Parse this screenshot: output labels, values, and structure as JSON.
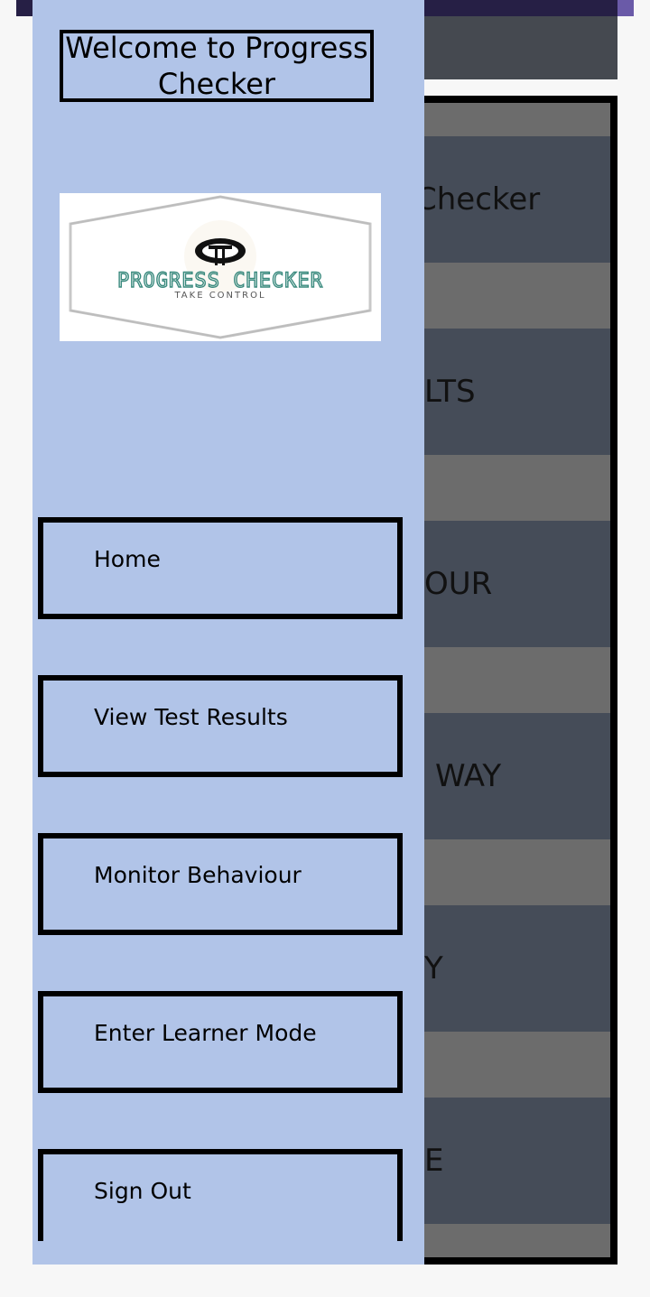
{
  "background": {
    "tiles": [
      {
        "text": "Checker"
      },
      {
        "text": "LTS"
      },
      {
        "text": "OUR"
      },
      {
        "text": "WAY"
      },
      {
        "text": "Y"
      },
      {
        "text": "E"
      }
    ]
  },
  "drawer": {
    "title": "Welcome to Progress Checker",
    "logo": {
      "brand": "PROGRESS CHECKER",
      "tagline": "TAKE CONTROL",
      "icon": "brain-icon"
    },
    "menu": [
      {
        "label": "Home"
      },
      {
        "label": "View Test Results"
      },
      {
        "label": "Monitor Behaviour"
      },
      {
        "label": "Enter Learner Mode"
      },
      {
        "label": "Sign Out"
      }
    ]
  },
  "colors": {
    "drawer": "#b1c4e8",
    "app_bar": "#261f45",
    "accent": "#6a5aa8",
    "tile": "#454c58",
    "logo_text": "#3a8a7e"
  }
}
